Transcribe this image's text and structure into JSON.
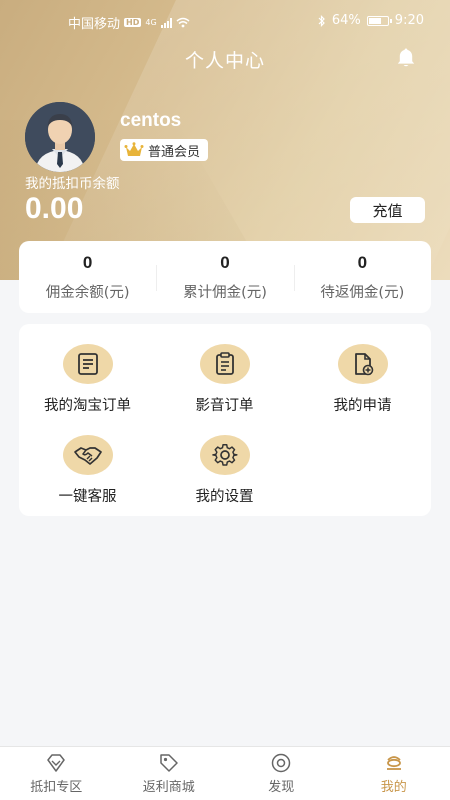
{
  "status_bar": {
    "carrier": "中国移动",
    "hd": "HD",
    "network": "4G",
    "battery": "64%",
    "time": "9:20"
  },
  "header": {
    "title": "个人中心",
    "icons": {
      "notification": "bell-icon"
    }
  },
  "profile": {
    "username": "centos",
    "member_level": "普通会员",
    "balance_label": "我的抵扣币余额",
    "balance_value": "0.00",
    "recharge_label": "充值"
  },
  "stats": [
    {
      "value": "0",
      "label": "佣金余额(元)"
    },
    {
      "value": "0",
      "label": "累计佣金(元)"
    },
    {
      "value": "0",
      "label": "待返佣金(元)"
    }
  ],
  "menu": [
    {
      "label": "我的淘宝订单",
      "icon": "document-list-icon"
    },
    {
      "label": "影音订单",
      "icon": "clipboard-icon"
    },
    {
      "label": "我的申请",
      "icon": "file-add-icon"
    },
    {
      "label": "一键客服",
      "icon": "handshake-icon"
    },
    {
      "label": "我的设置",
      "icon": "gear-icon"
    }
  ],
  "bottom_nav": [
    {
      "label": "抵扣专区",
      "icon": "diamond-icon",
      "active": false
    },
    {
      "label": "返利商城",
      "icon": "tag-icon",
      "active": false
    },
    {
      "label": "发现",
      "icon": "eye-icon",
      "active": false
    },
    {
      "label": "我的",
      "icon": "user-icon",
      "active": true
    }
  ],
  "colors": {
    "hero_gold": "#d6bc8e",
    "menu_icon_bg": "#efd8a8",
    "nav_active": "#c8964a",
    "page_bg": "#f5f6f8"
  }
}
